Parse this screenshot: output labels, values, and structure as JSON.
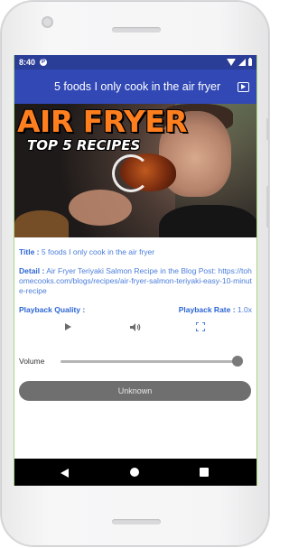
{
  "statusbar": {
    "time": "8:40"
  },
  "appbar": {
    "title": "5 foods I only cook in the air fryer"
  },
  "video": {
    "heading": "AIR FRYER",
    "subheading": "TOP 5 RECIPES"
  },
  "info": {
    "title_label": "Title :",
    "title_value": "5 foods I only cook in the air fryer",
    "detail_label": "Detail :",
    "detail_value": "Air Fryer Teriyaki Salmon Recipe in the Blog Post: https://tohomecooks.com/blogs/recipes/air-fryer-salmon-teriyaki-easy-10-minute-recipe",
    "quality_label": "Playback Quality :",
    "quality_value": "",
    "rate_label": "Playback Rate :",
    "rate_value": "1.0x"
  },
  "volume": {
    "label": "Volume",
    "level": 0.97
  },
  "button": {
    "label": "Unknown"
  },
  "colors": {
    "statusbar": "#2a3d97",
    "appbar": "#3148b5",
    "accent_text": "#2c66d4"
  },
  "icons": [
    "play-icon",
    "volume-icon",
    "fullscreen-icon",
    "back-icon",
    "home-icon",
    "recents-icon"
  ]
}
